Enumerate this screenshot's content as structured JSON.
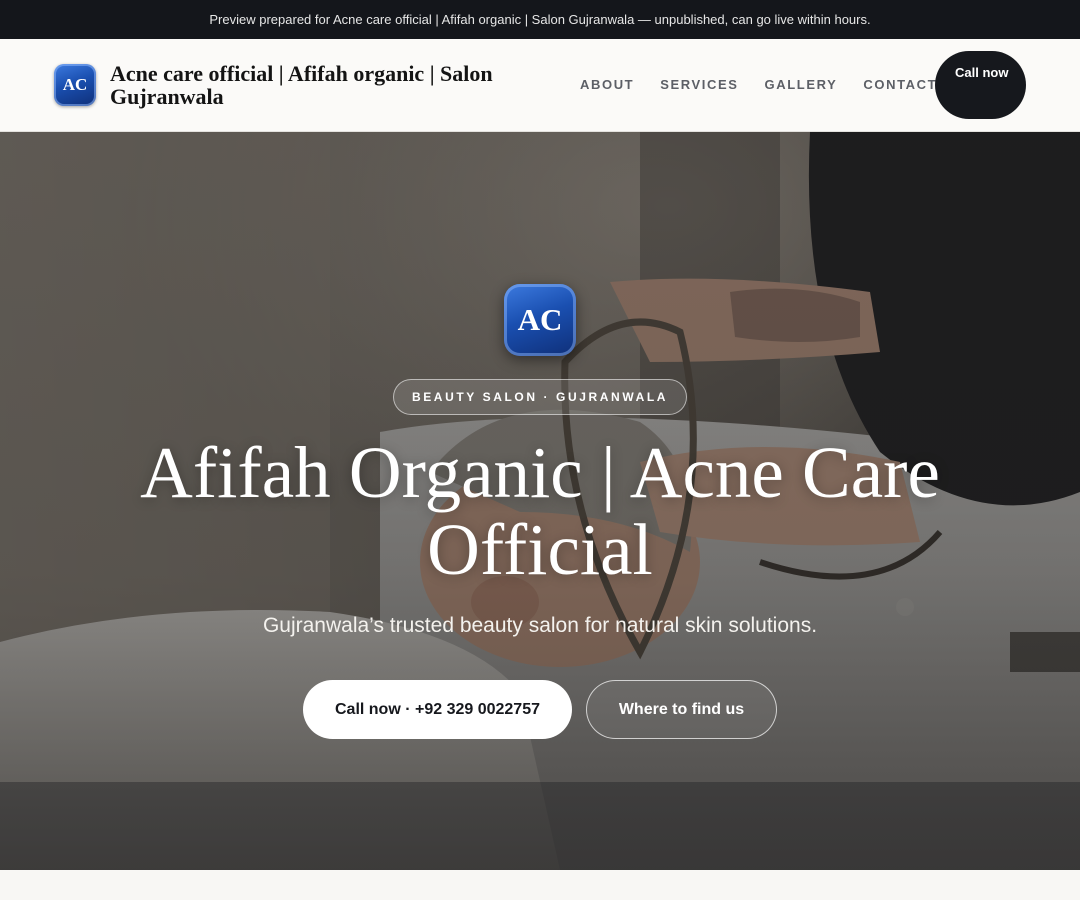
{
  "preview_bar": {
    "text": "Preview prepared for Acne care official | Afifah organic | Salon Gujranwala — unpublished, can go live within hours."
  },
  "header": {
    "logo_initials": "AC",
    "brand_name": "Acne care official | Afifah organic | Salon Gujranwala",
    "nav": [
      "ABOUT",
      "SERVICES",
      "GALLERY",
      "CONTACT"
    ],
    "call_button": "Call now"
  },
  "hero": {
    "logo_initials": "AC",
    "badge": "BEAUTY SALON · GUJRANWALA",
    "title": "Afifah Organic | Acne Care Official",
    "subtitle": "Gujranwala’s trusted beauty salon for natural skin solutions.",
    "primary_button": "Call now · +92 329 0022757",
    "secondary_button": "Where to find us"
  },
  "colors": {
    "top_bar": "#14161b",
    "header_bg": "#fbfaf8",
    "accent_dark": "#16181d",
    "logo_blue": "#1a4fb0"
  }
}
